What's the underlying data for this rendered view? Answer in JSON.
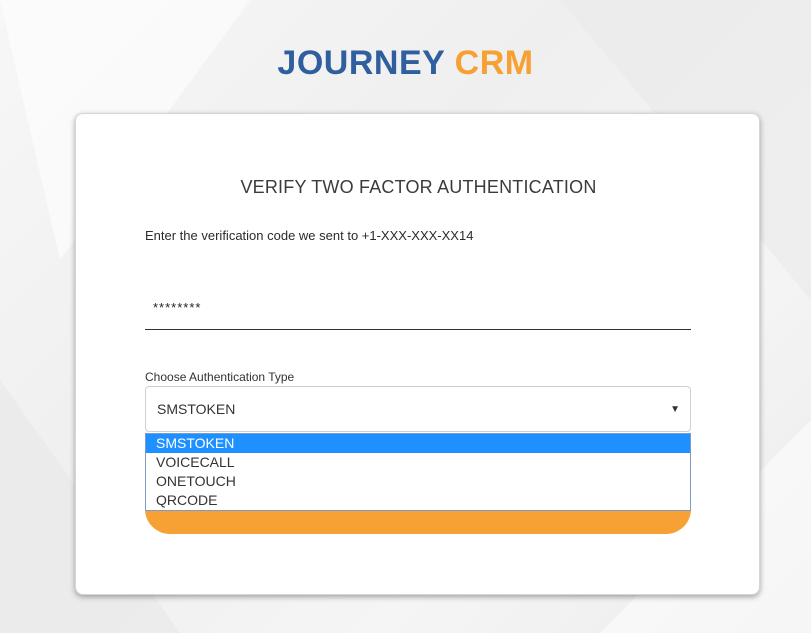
{
  "brand": {
    "part1": "JOURNEY",
    "part2": "CRM",
    "color_primary": "#2f5f9e",
    "color_accent": "#f7a033"
  },
  "card": {
    "title": "VERIFY TWO FACTOR AUTHENTICATION",
    "instruction": "Enter the verification code we sent to +1-XXX-XXX-XX14"
  },
  "code_input": {
    "value": "********"
  },
  "auth_type": {
    "label": "Choose Authentication Type",
    "selected": "SMSTOKEN",
    "arrow_icon": "caret-down-icon",
    "options": [
      "SMSTOKEN",
      "VOICECALL",
      "ONETOUCH",
      "QRCODE"
    ],
    "highlight_color": "#1e90ff"
  },
  "submit": {
    "color": "#f7a033"
  }
}
